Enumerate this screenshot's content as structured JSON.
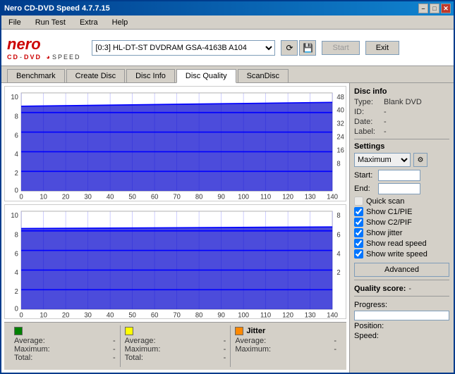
{
  "titlebar": {
    "title": "Nero CD-DVD Speed 4.7.7.15",
    "min": "–",
    "max": "□",
    "close": "✕"
  },
  "menu": {
    "items": [
      "File",
      "Run Test",
      "Extra",
      "Help"
    ]
  },
  "header": {
    "drive_value": "[0:3] HL-DT-ST DVDRAM GSA-4163B A104",
    "start_label": "Start",
    "exit_label": "Exit"
  },
  "tabs": [
    {
      "label": "Benchmark",
      "active": false
    },
    {
      "label": "Create Disc",
      "active": false
    },
    {
      "label": "Disc Info",
      "active": false
    },
    {
      "label": "Disc Quality",
      "active": true
    },
    {
      "label": "ScanDisc",
      "active": false
    }
  ],
  "disc_info": {
    "section_title": "Disc info",
    "type_label": "Type:",
    "type_value": "Blank DVD",
    "id_label": "ID:",
    "id_value": "-",
    "date_label": "Date:",
    "date_value": "-",
    "label_label": "Label:",
    "label_value": "-"
  },
  "settings": {
    "section_title": "Settings",
    "speed_value": "Maximum",
    "start_label": "Start:",
    "end_label": "End:",
    "quick_scan_label": "Quick scan",
    "checkboxes": [
      {
        "label": "Show C1/PIE",
        "checked": true
      },
      {
        "label": "Show C2/PIF",
        "checked": true
      },
      {
        "label": "Show jitter",
        "checked": true
      },
      {
        "label": "Show read speed",
        "checked": true
      },
      {
        "label": "Show write speed",
        "checked": true
      }
    ],
    "advanced_label": "Advanced"
  },
  "quality_score": {
    "label": "Quality score:",
    "value": "-"
  },
  "progress": {
    "progress_label": "Progress:",
    "position_label": "Position:",
    "speed_label": "Speed:",
    "progress_value": "",
    "position_value": "",
    "speed_value": ""
  },
  "stats": [
    {
      "color": "#008000",
      "title": "",
      "avg_label": "Average:",
      "avg_value": "-",
      "max_label": "Maximum:",
      "max_value": "-",
      "total_label": "Total:",
      "total_value": "-"
    },
    {
      "color": "#ffff00",
      "title": "",
      "avg_label": "Average:",
      "avg_value": "-",
      "max_label": "Maximum:",
      "max_value": "-",
      "total_label": "Total:",
      "total_value": "-"
    },
    {
      "color": "#ff8800",
      "title": "Jitter",
      "avg_label": "Average:",
      "avg_value": "-",
      "max_label": "Maximum:",
      "max_value": "-"
    }
  ]
}
